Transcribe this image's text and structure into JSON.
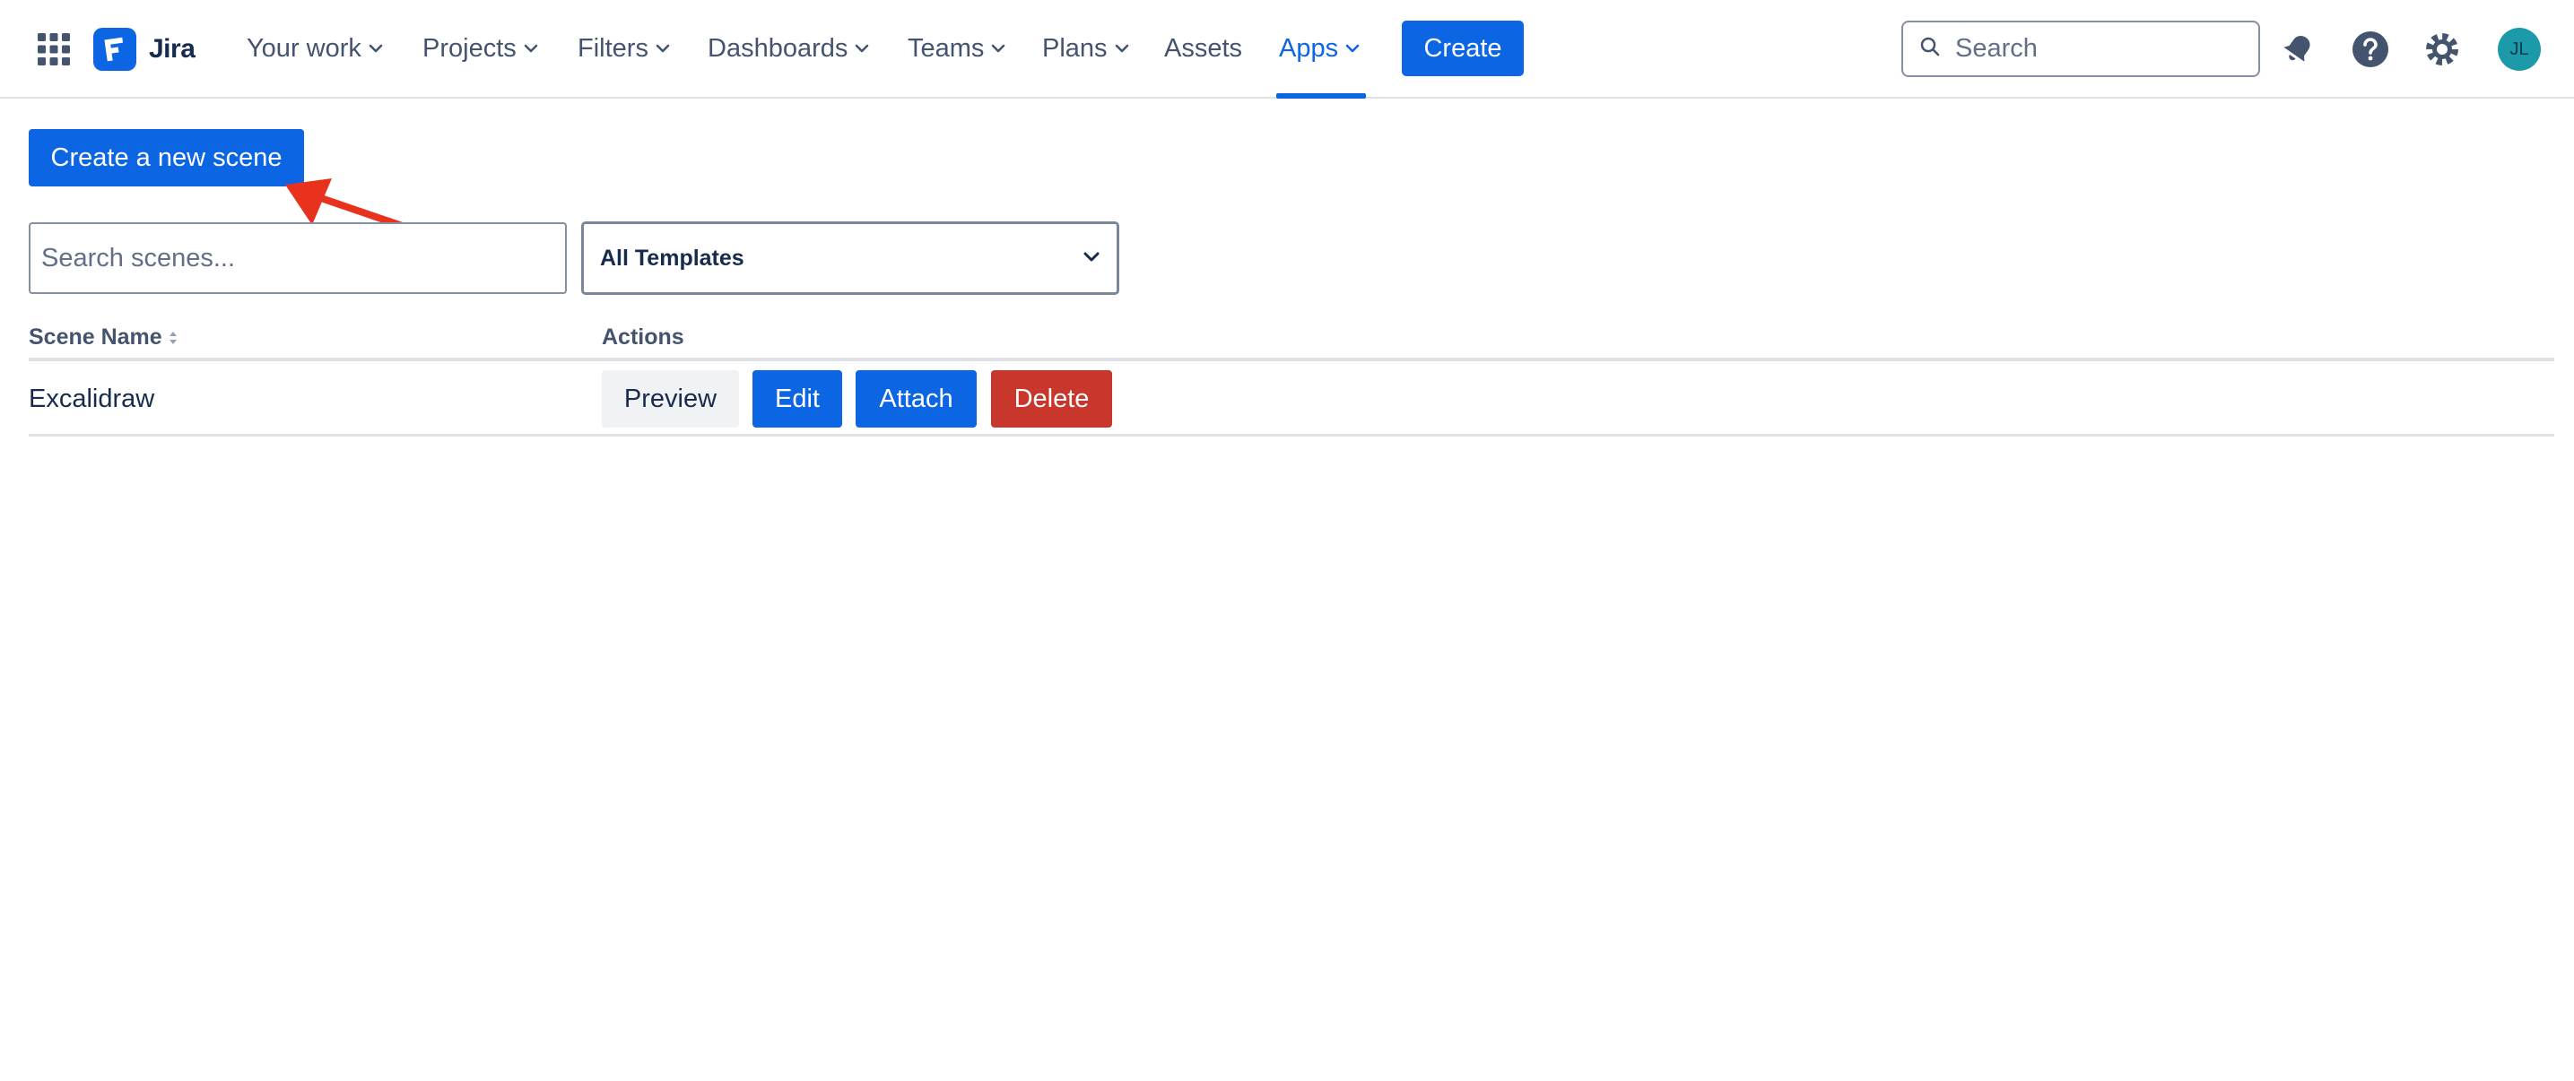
{
  "brand": {
    "name": "Jira"
  },
  "nav": {
    "items": [
      {
        "label": "Your work",
        "dropdown": true
      },
      {
        "label": "Projects",
        "dropdown": true
      },
      {
        "label": "Filters",
        "dropdown": true
      },
      {
        "label": "Dashboards",
        "dropdown": true
      },
      {
        "label": "Teams",
        "dropdown": true
      },
      {
        "label": "Plans",
        "dropdown": true
      },
      {
        "label": "Assets",
        "dropdown": false
      },
      {
        "label": "Apps",
        "dropdown": true,
        "active": true
      }
    ],
    "create_label": "Create",
    "search_placeholder": "Search",
    "icons": [
      "app-switcher-icon",
      "notifications-icon",
      "help-icon",
      "settings-icon"
    ],
    "avatar_initials": "JL"
  },
  "main": {
    "new_scene_label": "Create a new scene",
    "search_placeholder": "Search scenes...",
    "template_filter": "All Templates",
    "table": {
      "columns": [
        "Scene Name",
        "Actions"
      ],
      "rows": [
        {
          "name": "Excalidraw",
          "actions": [
            "Preview",
            "Edit",
            "Attach",
            "Delete"
          ]
        }
      ]
    }
  },
  "colors": {
    "primary": "#0c66e4",
    "danger": "#c9372c",
    "annotation_arrow": "#e8321e",
    "text": "#172b4d",
    "subtle_text": "#44546f"
  }
}
